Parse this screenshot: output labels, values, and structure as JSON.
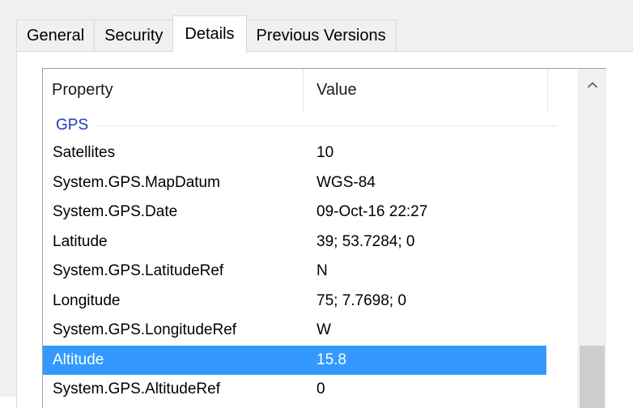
{
  "tabs": [
    {
      "label": "General",
      "active": false
    },
    {
      "label": "Security",
      "active": false
    },
    {
      "label": "Details",
      "active": true
    },
    {
      "label": "Previous Versions",
      "active": false
    }
  ],
  "columns": {
    "property": "Property",
    "value": "Value"
  },
  "group": {
    "label": "GPS"
  },
  "rows": [
    {
      "property": "Satellites",
      "value": "10"
    },
    {
      "property": "System.GPS.MapDatum",
      "value": "WGS-84"
    },
    {
      "property": "System.GPS.Date",
      "value": "09-Oct-16 22:27"
    },
    {
      "property": "Latitude",
      "value": "39; 53.7284; 0"
    },
    {
      "property": "System.GPS.LatitudeRef",
      "value": "N"
    },
    {
      "property": "Longitude",
      "value": "75; 7.7698; 0"
    },
    {
      "property": "System.GPS.LongitudeRef",
      "value": "W"
    },
    {
      "property": "Altitude",
      "value": "15.8"
    },
    {
      "property": "System.GPS.AltitudeRef",
      "value": "0"
    }
  ],
  "selected_row": "Altitude",
  "icons": {
    "scroll_up": "chevron-up-icon"
  },
  "colors": {
    "selection": "#3399ff",
    "group_label": "#1f3fb5"
  }
}
